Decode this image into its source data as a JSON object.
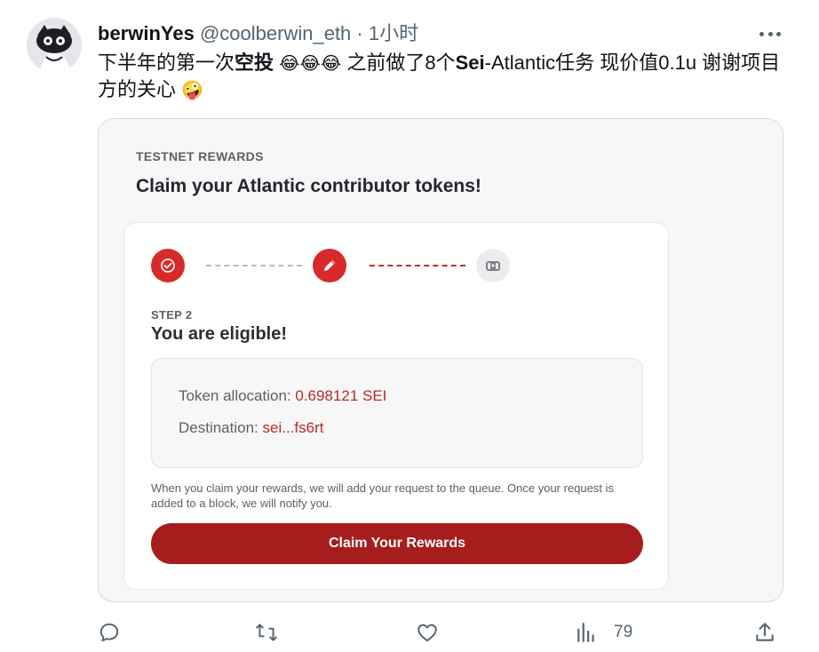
{
  "tweet": {
    "display_name": "berwinYes",
    "handle": "@coolberwin_eth",
    "separator": "·",
    "time": "1小时",
    "text": {
      "part1": "下半年的第一次",
      "bold1": "空投",
      "emojis1": "😂😂😂",
      "part2": " 之前做了8个",
      "bold2": "Sei",
      "part3": "-Atlantic任务 现价值0.1u  谢谢项目方的关心 ",
      "emoji2": "🤪"
    }
  },
  "card": {
    "eyebrow": "TESTNET REWARDS",
    "title": "Claim your Atlantic contributor tokens!",
    "steps": {
      "current_label": "STEP 2",
      "current_title": "You are eligible!"
    },
    "allocation": {
      "label": "Token allocation: ",
      "value": "0.698121 SEI"
    },
    "destination": {
      "label": "Destination: ",
      "value": "sei...fs6rt"
    },
    "notice": "When you claim your rewards, we will add your request to the queue. Once your request is added to a block, we will notify you.",
    "button_label": "Claim Your Rewards",
    "colors": {
      "accent": "#d72b2b",
      "button": "#a51d1d",
      "value_text": "#b52b27"
    }
  },
  "actions": {
    "views_count": "79"
  },
  "icons": {
    "avatar": "cat-avatar",
    "step1": "check-icon",
    "step2": "pencil-icon",
    "step3": "treasure-chest-icon",
    "reply": "reply-icon",
    "retweet": "retweet-icon",
    "like": "heart-icon",
    "views": "views-chart-icon",
    "share": "share-icon"
  }
}
